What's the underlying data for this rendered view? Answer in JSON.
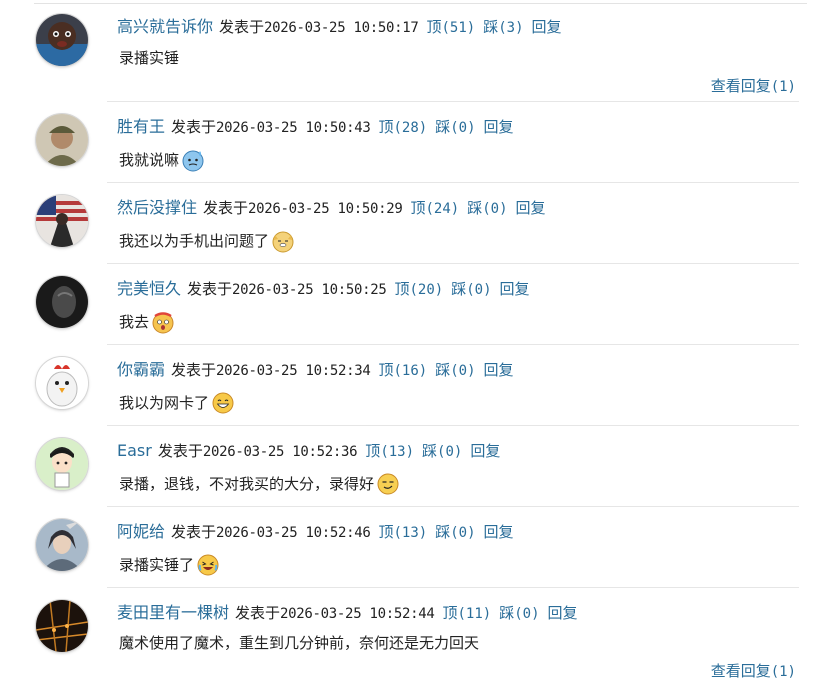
{
  "labels": {
    "posted": "发表于",
    "up": "顶",
    "down": "踩",
    "reply": "回复",
    "view_replies": "查看回复"
  },
  "comments": [
    {
      "user": "高兴就告诉你",
      "time": "2026-03-25 10:50:17",
      "up": "(51)",
      "down": "(3)",
      "text": "录播实锤",
      "emoji": "",
      "replies": "(1)",
      "avatar_icon": "baby-avatar-icon"
    },
    {
      "user": "胜有王",
      "time": "2026-03-25 10:50:43",
      "up": "(28)",
      "down": "(0)",
      "text": "我就说嘛",
      "emoji": "sweat-emoji-icon",
      "replies": "",
      "avatar_icon": "soldier-avatar-icon"
    },
    {
      "user": "然后没撑住",
      "time": "2026-03-25 10:50:29",
      "up": "(24)",
      "down": "(0)",
      "text": "我还以为手机出问题了",
      "emoji": "doge-emoji-icon",
      "replies": "",
      "avatar_icon": "flag-figure-avatar-icon"
    },
    {
      "user": "完美恒久",
      "time": "2026-03-25 10:50:25",
      "up": "(20)",
      "down": "(0)",
      "text": "我去",
      "emoji": "shocked-emoji-icon",
      "replies": "",
      "avatar_icon": "dark-portrait-avatar-icon"
    },
    {
      "user": "你霸霸",
      "time": "2026-03-25 10:52:34",
      "up": "(16)",
      "down": "(0)",
      "text": "我以为网卡了",
      "emoji": "grin-emoji-icon",
      "replies": "",
      "avatar_icon": "chicken-avatar-icon"
    },
    {
      "user": "Easr",
      "time": "2026-03-25 10:52:36",
      "up": "(13)",
      "down": "(0)",
      "text": "录播，退钱，不对我买的大分，录得好",
      "emoji": "smug-emoji-icon",
      "replies": "",
      "avatar_icon": "cartoon-boy-avatar-icon"
    },
    {
      "user": "阿妮给",
      "time": "2026-03-25 10:52:46",
      "up": "(13)",
      "down": "(0)",
      "text": "录播实锤了",
      "emoji": "crying-laugh-emoji-icon",
      "replies": "",
      "avatar_icon": "warrior-avatar-icon"
    },
    {
      "user": "麦田里有一棵树",
      "time": "2026-03-25 10:52:44",
      "up": "(11)",
      "down": "(0)",
      "text": "魔术使用了魔术，重生到几分钟前，奈何还是无力回天",
      "emoji": "",
      "replies": "(1)",
      "avatar_icon": "night-lights-avatar-icon"
    }
  ],
  "colors": {
    "link": "#2a6d99",
    "text": "#222222",
    "separator": "#e6e6e6"
  }
}
